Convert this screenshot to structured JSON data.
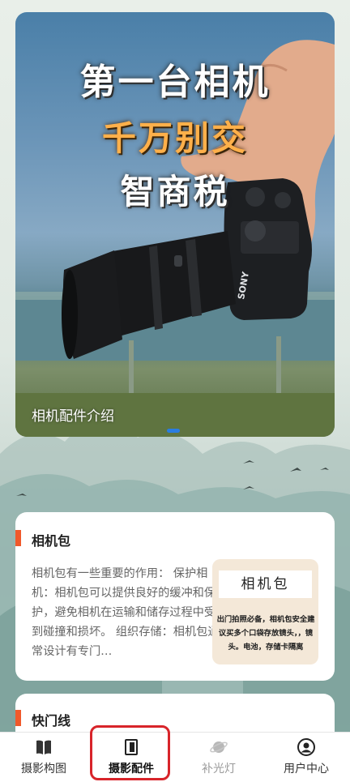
{
  "banner": {
    "line1": "第一台相机",
    "line2": "千万别交",
    "line3": "智商税",
    "caption": "相机配件介绍",
    "camera_brand": "SONY"
  },
  "cards": [
    {
      "title": "相机包",
      "body": "相机包有一些重要的作用：  保护相机：相机包可以提供良好的缓冲和保护，避免相机在运输和储存过程中受到碰撞和损坏。  组织存储：相机包通常设计有专门…",
      "thumb_title": "相机包",
      "thumb_text": "出门拍照必备，相机包安全建议买多个口袋存放镜头，，镜头。电池，存储卡隔离"
    },
    {
      "title": "快门线"
    }
  ],
  "nav": {
    "items": [
      {
        "label": "摄影构图",
        "icon": "book-icon"
      },
      {
        "label": "摄影配件",
        "icon": "door-icon"
      },
      {
        "label": "补光灯",
        "icon": "planet-icon"
      },
      {
        "label": "用户中心",
        "icon": "user-icon"
      }
    ]
  },
  "colors": {
    "accent": "#f0592b",
    "active_highlight": "#d8242a",
    "headline_orange": "#ffb04a",
    "indicator": "#2a7de1"
  }
}
